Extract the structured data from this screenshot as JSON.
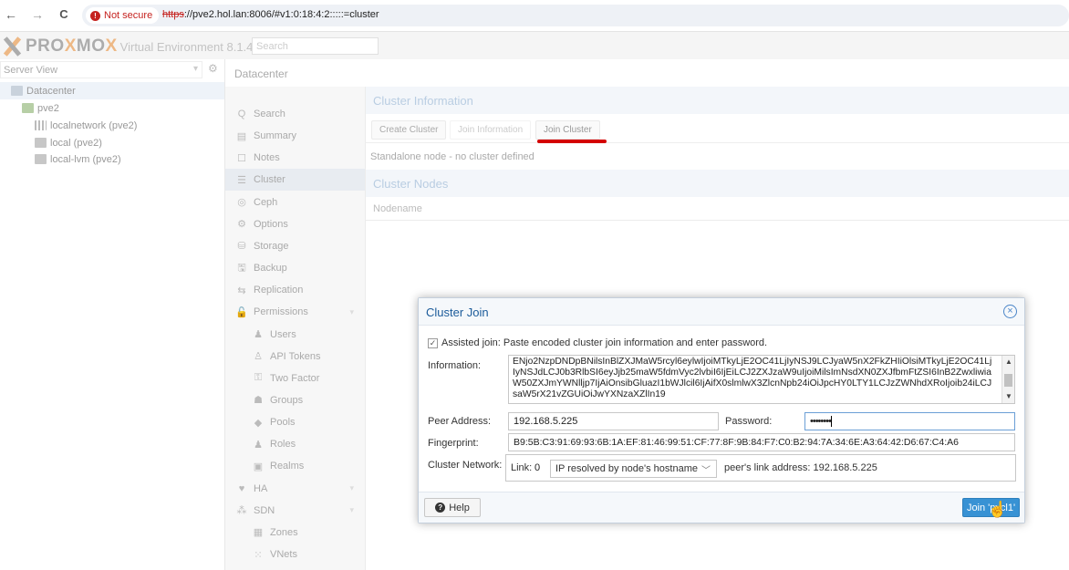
{
  "browser": {
    "back": "←",
    "forward": "→",
    "reload": "C",
    "not_secure": "Not secure",
    "url_scheme": "https",
    "url_rest": "://pve2.hol.lan:8006/#v1:0:18:4:2:::::=cluster"
  },
  "header": {
    "version": "Virtual Environment 8.1.4",
    "search_placeholder": "Search"
  },
  "sidebar": {
    "view": "Server View",
    "tree": [
      {
        "label": "Datacenter",
        "icon": "datacenter-icon",
        "selected": true
      },
      {
        "label": "pve2",
        "icon": "node-icon"
      },
      {
        "label": "localnetwork (pve2)",
        "icon": "network-icon"
      },
      {
        "label": "local (pve2)",
        "icon": "storage-icon"
      },
      {
        "label": "local-lvm (pve2)",
        "icon": "storage-icon"
      }
    ]
  },
  "breadcrumb": "Datacenter",
  "menu": [
    {
      "label": "Search",
      "icon": "Q"
    },
    {
      "label": "Summary",
      "icon": "▤"
    },
    {
      "label": "Notes",
      "icon": "☐"
    },
    {
      "label": "Cluster",
      "icon": "☰",
      "selected": true
    },
    {
      "label": "Ceph",
      "icon": "◎"
    },
    {
      "label": "Options",
      "icon": "⚙"
    },
    {
      "label": "Storage",
      "icon": "⛁"
    },
    {
      "label": "Backup",
      "icon": "🖫"
    },
    {
      "label": "Replication",
      "icon": "⇆"
    },
    {
      "label": "Permissions",
      "icon": "🔓",
      "chevron": true
    },
    {
      "label": "Users",
      "icon": "♟",
      "sub": true
    },
    {
      "label": "API Tokens",
      "icon": "♙",
      "sub": true
    },
    {
      "label": "Two Factor",
      "icon": "⚿",
      "sub": true
    },
    {
      "label": "Groups",
      "icon": "☗",
      "sub": true
    },
    {
      "label": "Pools",
      "icon": "◆",
      "sub": true
    },
    {
      "label": "Roles",
      "icon": "♟",
      "sub": true
    },
    {
      "label": "Realms",
      "icon": "▣",
      "sub": true
    },
    {
      "label": "HA",
      "icon": "♥",
      "chevron": true
    },
    {
      "label": "SDN",
      "icon": "⁂",
      "chevron": true
    },
    {
      "label": "Zones",
      "icon": "▦",
      "sub": true
    },
    {
      "label": "VNets",
      "icon": "⁙",
      "sub": true
    }
  ],
  "cluster": {
    "info_title": "Cluster Information",
    "create_btn": "Create Cluster",
    "join_info_btn": "Join Information",
    "join_cluster_btn": "Join Cluster",
    "standalone": "Standalone node - no cluster defined",
    "nodes_title": "Cluster Nodes",
    "nodename_col": "Nodename"
  },
  "dialog": {
    "title": "Cluster Join",
    "assisted": "Assisted join: Paste encoded cluster join information and enter password.",
    "information_label": "Information:",
    "information_value": "ENjo2NzpDNDpBNilsInBlZXJMaW5rcyl6eylwIjoiMTkyLjE2OC41LjIyNSJ9LCJyaW5nX2FkZHIiOlsiMTkyLjE2OC41LjIyNSJdLCJ0b3RlbSI6eyJjb25maW5fdmVyc2lvbiI6IjEiLCJ2ZXJzaW9uIjoiMilsImNsdXN0ZXJfbmFtZSI6InB2ZwxliwiaW50ZXJmYWNlljp7IjAiOnsibGluazI1bWJlcil6IjAifX0slmlwX3ZlcnNpb24iOiJpcHY0LTY1LCJzZWNhdXRoIjoib24iLCJsaW5rX21vZGUiOiJwYXNzaXZlIn19",
    "peer_address_label": "Peer Address:",
    "peer_address": "192.168.5.225",
    "password_label": "Password:",
    "password_mask": "••••••••",
    "fingerprint_label": "Fingerprint:",
    "fingerprint": "B9:5B:C3:91:69:93:6B:1A:EF:81:46:99:51:CF:77:8F:9B:84:F7:C0:B2:94:7A:34:6E:A3:64:42:D6:67:C4:A6",
    "network_label": "Cluster Network:",
    "link_label": "Link:",
    "link_number": "0",
    "ip_select": "IP resolved by node's hostname",
    "peer_link": "peer's link address: 192.168.5.225",
    "help": "Help",
    "join": "Join 'pvcl1'"
  }
}
